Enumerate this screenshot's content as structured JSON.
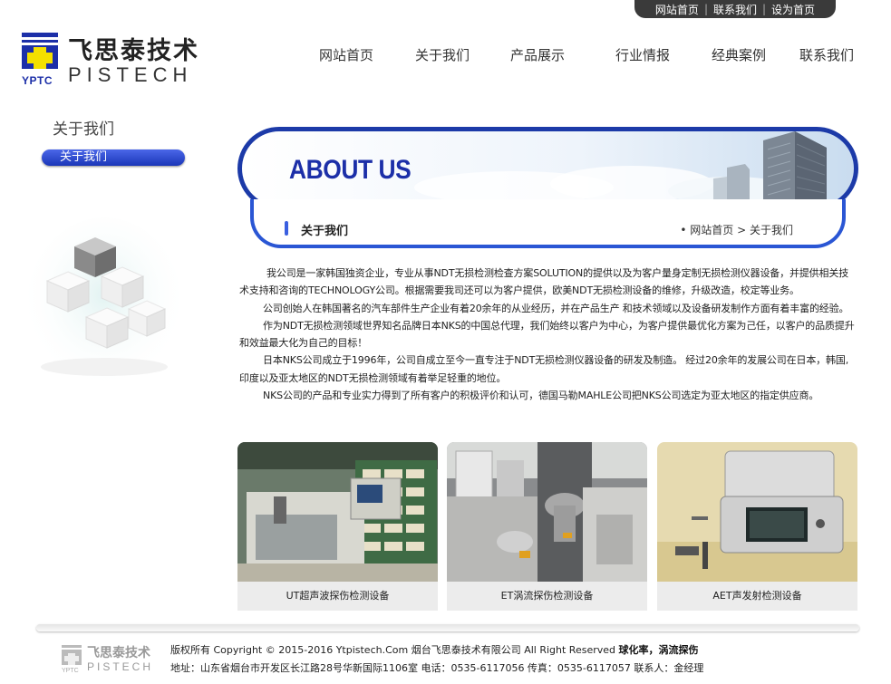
{
  "topbar": {
    "links": [
      "网站首页",
      "联系我们",
      "设为首页"
    ]
  },
  "logo": {
    "chinese": "飞思泰技术",
    "english": "PISTECH",
    "abbr": "YPTC",
    "brand_color": "#1c2fa8",
    "accent_color": "#f4e000"
  },
  "nav": {
    "items": [
      "网站首页",
      "关于我们",
      "产品展示",
      "行业情报",
      "经典案例",
      "联系我们"
    ]
  },
  "sidebar": {
    "title": "关于我们",
    "items": [
      "关于我们"
    ]
  },
  "banner": {
    "heading": "ABOUT US",
    "section_title": "关于我们",
    "breadcrumb": [
      "网站首页",
      "关于我们"
    ]
  },
  "article": {
    "paragraphs": [
      "我公司是一家韩国独资企业，专业从事NDT无损检测检查方案SOLUTION的提供以及为客户量身定制无损检测仪器设备，并提供相关技术支持和咨询的TECHNOLOGY公司。根据需要我司还可以为客户提供，欧美NDT无损检测设备的维修，升级改造，校定等业务。",
      "公司创始人在韩国著名的汽车部件生产企业有着20余年的从业经历，并在产品生产 和技术领域以及设备研发制作方面有着丰富的经验。",
      "作为NDT无损检测领域世界知名品牌日本NKS的中国总代理，我们始终以客户为中心，为客户提供最优化方案为己任，以客户的品质提升和效益最大化为自己的目标！",
      "日本NKS公司成立于1996年，公司自成立至今一直专注于NDT无损检测仪器设备的研发及制造。 经过20余年的发展公司在日本，韩国, 印度以及亚太地区的NDT无损检测领域有着举足轻重的地位。",
      "NKS公司的产品和专业实力得到了所有客户的积极评价和认可，德国马勒MAHLE公司把NKS公司选定为亚太地区的指定供应商。"
    ]
  },
  "products": [
    {
      "caption": "UT超声波探伤检测设备",
      "icon": "ut-machine-photo"
    },
    {
      "caption": "ET涡流探伤检测设备",
      "icon": "et-machine-photo"
    },
    {
      "caption": "AET声发射检测设备",
      "icon": "aet-case-photo"
    }
  ],
  "footer": {
    "copyright_prefix": "版权所有 Copyright © 2015-2016 Ytpistech.Com 烟台飞思泰技术有限公司 All Right Reserved ",
    "keywords": "球化率，涡流探伤",
    "address": "地址：山东省烟台市开发区长江路28号华新国际1106室  电话：0535-6117056  传真：0535-6117057  联系人：金经理",
    "logo_chinese": "飞思泰技术",
    "logo_english": "PISTECH",
    "logo_abbr": "YPTC"
  }
}
